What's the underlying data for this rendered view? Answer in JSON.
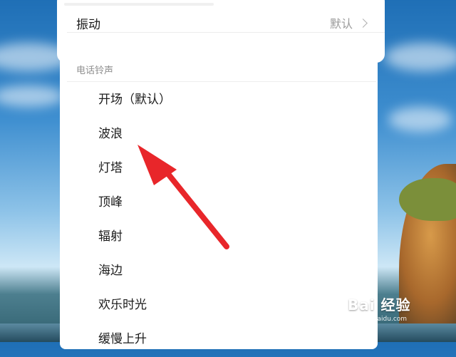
{
  "vibrate": {
    "label": "振动",
    "value": "默认"
  },
  "ringtone_section": {
    "header": "电话铃声",
    "items": [
      "开场（默认）",
      "波浪",
      "灯塔",
      "顶峰",
      "辐射",
      "海边",
      "欢乐时光",
      "缓慢上升"
    ]
  },
  "watermark": {
    "brand": "Bai 经验",
    "url": "jingyan.baidu.com"
  },
  "colors": {
    "arrow": "#e8262a",
    "header_text": "#8f8f8f",
    "value_text": "#9a9a9a"
  },
  "icons": {
    "chevron": "chevron-right-icon",
    "arrow": "red-annotation-arrow"
  }
}
